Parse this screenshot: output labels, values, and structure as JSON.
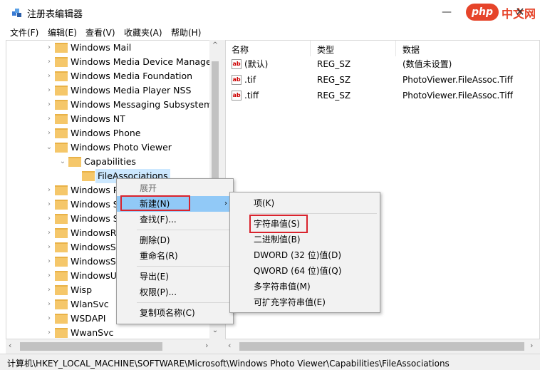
{
  "window": {
    "title": "注册表编辑器",
    "minimize_glyph": "—",
    "close_glyph": "✕"
  },
  "watermark": {
    "php": "php",
    "text": "中文网"
  },
  "menubar": [
    "文件(F)",
    "编辑(E)",
    "查看(V)",
    "收藏夹(A)",
    "帮助(H)"
  ],
  "tree": [
    {
      "label": "Windows Mail",
      "arrow": "›",
      "indent": 0
    },
    {
      "label": "Windows Media Device Manager",
      "arrow": "›",
      "indent": 0
    },
    {
      "label": "Windows Media Foundation",
      "arrow": "›",
      "indent": 0
    },
    {
      "label": "Windows Media Player NSS",
      "arrow": "›",
      "indent": 0
    },
    {
      "label": "Windows Messaging Subsystem",
      "arrow": "›",
      "indent": 0
    },
    {
      "label": "Windows NT",
      "arrow": "›",
      "indent": 0
    },
    {
      "label": "Windows Phone",
      "arrow": "›",
      "indent": 0
    },
    {
      "label": "Windows Photo Viewer",
      "arrow": "⌄",
      "indent": 0
    },
    {
      "label": "Capabilities",
      "arrow": "⌄",
      "indent": 1
    },
    {
      "label": "FileAssociations",
      "arrow": "",
      "indent": 2,
      "selected": true
    },
    {
      "label": "Windows P",
      "arrow": "›",
      "indent": 0
    },
    {
      "label": "Windows S",
      "arrow": "›",
      "indent": 0
    },
    {
      "label": "Windows S",
      "arrow": "›",
      "indent": 0
    },
    {
      "label": "WindowsR",
      "arrow": "›",
      "indent": 0
    },
    {
      "label": "WindowsSe",
      "arrow": "›",
      "indent": 0
    },
    {
      "label": "WindowsSt",
      "arrow": "›",
      "indent": 0
    },
    {
      "label": "WindowsU",
      "arrow": "›",
      "indent": 0
    },
    {
      "label": "Wisp",
      "arrow": "›",
      "indent": 0
    },
    {
      "label": "WlanSvc",
      "arrow": "›",
      "indent": 0
    },
    {
      "label": "WSDAPI",
      "arrow": "›",
      "indent": 0
    },
    {
      "label": "WwanSvc",
      "arrow": "›",
      "indent": 0
    }
  ],
  "list": {
    "columns": [
      "名称",
      "类型",
      "数据"
    ],
    "rows": [
      {
        "name": "(默认)",
        "type": "REG_SZ",
        "data": "(数值未设置)"
      },
      {
        "name": ".tif",
        "type": "REG_SZ",
        "data": "PhotoViewer.FileAssoc.Tiff"
      },
      {
        "name": ".tiff",
        "type": "REG_SZ",
        "data": "PhotoViewer.FileAssoc.Tiff"
      }
    ],
    "icon_text": "ab"
  },
  "context_menu": {
    "items": [
      "展开",
      "新建(N)",
      "查找(F)...",
      "删除(D)",
      "重命名(R)",
      "导出(E)",
      "权限(P)...",
      "复制项名称(C)"
    ],
    "submenu_arrow": "›"
  },
  "submenu": {
    "items": [
      "项(K)",
      "字符串值(S)",
      "二进制值(B)",
      "DWORD (32 位)值(D)",
      "QWORD (64 位)值(Q)",
      "多字符串值(M)",
      "可扩充字符串值(E)"
    ]
  },
  "scroll": {
    "left": "‹",
    "right": "›",
    "up": "^",
    "down": "⌄"
  },
  "statusbar": {
    "path": "计算机\\HKEY_LOCAL_MACHINE\\SOFTWARE\\Microsoft\\Windows Photo Viewer\\Capabilities\\FileAssociations"
  },
  "colors": {
    "selection": "#cce8ff",
    "menu_hover": "#91c9f7",
    "highlight_box": "#d9232d",
    "folder": "#f5c76a"
  }
}
